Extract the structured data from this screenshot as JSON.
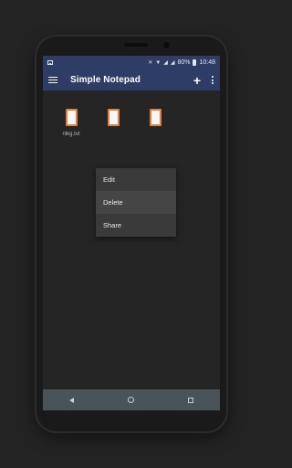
{
  "status_bar": {
    "notification_icon": "image-icon",
    "battery": "80%",
    "time": "10:48"
  },
  "app_bar": {
    "title": "Simple Notepad",
    "add_icon": "plus-icon",
    "more_icon": "more-vert-icon"
  },
  "files": [
    {
      "label": "nlkg.txt"
    },
    {
      "label": ""
    },
    {
      "label": ""
    }
  ],
  "context_menu": {
    "items": [
      {
        "label": "Edit"
      },
      {
        "label": "Delete"
      },
      {
        "label": "Share"
      }
    ],
    "highlighted_item": "Delete"
  },
  "nav_bar": {
    "back_icon": "back-icon",
    "home_icon": "home-icon",
    "recents_icon": "recents-icon"
  },
  "colors": {
    "app_bar": "#2d3d66",
    "background": "#252525",
    "doc_border": "#e27f3a",
    "menu_background": "#3a3a3a",
    "nav_bar": "#4a5358"
  }
}
